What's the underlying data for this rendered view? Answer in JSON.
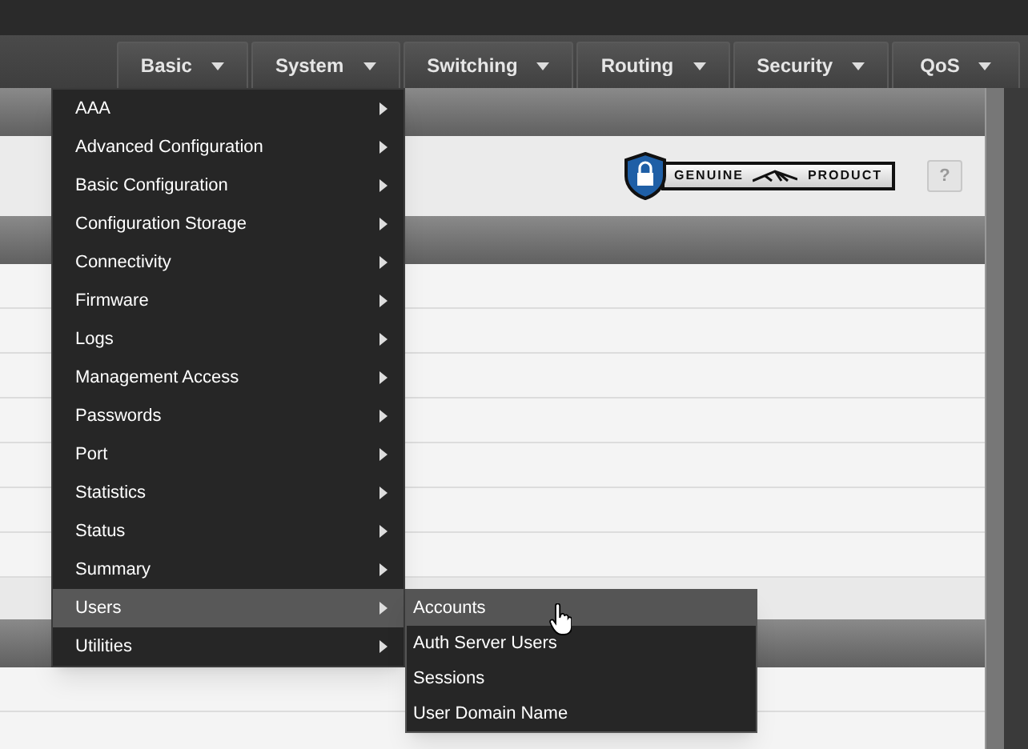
{
  "nav": {
    "tabs": [
      {
        "label": "Basic"
      },
      {
        "label": "System"
      },
      {
        "label": "Switching"
      },
      {
        "label": "Routing"
      },
      {
        "label": "Security"
      },
      {
        "label": "QoS"
      }
    ]
  },
  "badge": {
    "left": "GENUINE",
    "right": "PRODUCT"
  },
  "help_button": "?",
  "menu": {
    "items": [
      {
        "label": "AAA",
        "selected": false
      },
      {
        "label": "Advanced Configuration",
        "selected": false
      },
      {
        "label": "Basic Configuration",
        "selected": false
      },
      {
        "label": "Configuration Storage",
        "selected": false
      },
      {
        "label": "Connectivity",
        "selected": false
      },
      {
        "label": "Firmware",
        "selected": false
      },
      {
        "label": "Logs",
        "selected": false
      },
      {
        "label": "Management Access",
        "selected": false
      },
      {
        "label": "Passwords",
        "selected": false
      },
      {
        "label": "Port",
        "selected": false
      },
      {
        "label": "Statistics",
        "selected": false
      },
      {
        "label": "Status",
        "selected": false
      },
      {
        "label": "Summary",
        "selected": false
      },
      {
        "label": "Users",
        "selected": true
      },
      {
        "label": "Utilities",
        "selected": false
      }
    ]
  },
  "submenu": {
    "items": [
      {
        "label": "Accounts",
        "selected": true
      },
      {
        "label": "Auth Server Users",
        "selected": false
      },
      {
        "label": "Sessions",
        "selected": false
      },
      {
        "label": "User Domain Name",
        "selected": false
      }
    ]
  }
}
